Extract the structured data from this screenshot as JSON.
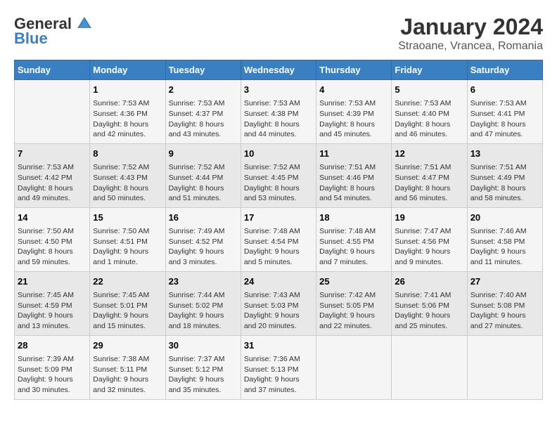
{
  "header": {
    "logo_general": "General",
    "logo_blue": "Blue",
    "month": "January 2024",
    "location": "Straoane, Vrancea, Romania"
  },
  "weekdays": [
    "Sunday",
    "Monday",
    "Tuesday",
    "Wednesday",
    "Thursday",
    "Friday",
    "Saturday"
  ],
  "weeks": [
    [
      {
        "day": "",
        "sunrise": "",
        "sunset": "",
        "daylight": ""
      },
      {
        "day": "1",
        "sunrise": "7:53 AM",
        "sunset": "4:36 PM",
        "daylight": "8 hours and 42 minutes."
      },
      {
        "day": "2",
        "sunrise": "7:53 AM",
        "sunset": "4:37 PM",
        "daylight": "8 hours and 43 minutes."
      },
      {
        "day": "3",
        "sunrise": "7:53 AM",
        "sunset": "4:38 PM",
        "daylight": "8 hours and 44 minutes."
      },
      {
        "day": "4",
        "sunrise": "7:53 AM",
        "sunset": "4:39 PM",
        "daylight": "8 hours and 45 minutes."
      },
      {
        "day": "5",
        "sunrise": "7:53 AM",
        "sunset": "4:40 PM",
        "daylight": "8 hours and 46 minutes."
      },
      {
        "day": "6",
        "sunrise": "7:53 AM",
        "sunset": "4:41 PM",
        "daylight": "8 hours and 47 minutes."
      }
    ],
    [
      {
        "day": "7",
        "sunrise": "7:53 AM",
        "sunset": "4:42 PM",
        "daylight": "8 hours and 49 minutes."
      },
      {
        "day": "8",
        "sunrise": "7:52 AM",
        "sunset": "4:43 PM",
        "daylight": "8 hours and 50 minutes."
      },
      {
        "day": "9",
        "sunrise": "7:52 AM",
        "sunset": "4:44 PM",
        "daylight": "8 hours and 51 minutes."
      },
      {
        "day": "10",
        "sunrise": "7:52 AM",
        "sunset": "4:45 PM",
        "daylight": "8 hours and 53 minutes."
      },
      {
        "day": "11",
        "sunrise": "7:51 AM",
        "sunset": "4:46 PM",
        "daylight": "8 hours and 54 minutes."
      },
      {
        "day": "12",
        "sunrise": "7:51 AM",
        "sunset": "4:47 PM",
        "daylight": "8 hours and 56 minutes."
      },
      {
        "day": "13",
        "sunrise": "7:51 AM",
        "sunset": "4:49 PM",
        "daylight": "8 hours and 58 minutes."
      }
    ],
    [
      {
        "day": "14",
        "sunrise": "7:50 AM",
        "sunset": "4:50 PM",
        "daylight": "8 hours and 59 minutes."
      },
      {
        "day": "15",
        "sunrise": "7:50 AM",
        "sunset": "4:51 PM",
        "daylight": "9 hours and 1 minute."
      },
      {
        "day": "16",
        "sunrise": "7:49 AM",
        "sunset": "4:52 PM",
        "daylight": "9 hours and 3 minutes."
      },
      {
        "day": "17",
        "sunrise": "7:48 AM",
        "sunset": "4:54 PM",
        "daylight": "9 hours and 5 minutes."
      },
      {
        "day": "18",
        "sunrise": "7:48 AM",
        "sunset": "4:55 PM",
        "daylight": "9 hours and 7 minutes."
      },
      {
        "day": "19",
        "sunrise": "7:47 AM",
        "sunset": "4:56 PM",
        "daylight": "9 hours and 9 minutes."
      },
      {
        "day": "20",
        "sunrise": "7:46 AM",
        "sunset": "4:58 PM",
        "daylight": "9 hours and 11 minutes."
      }
    ],
    [
      {
        "day": "21",
        "sunrise": "7:45 AM",
        "sunset": "4:59 PM",
        "daylight": "9 hours and 13 minutes."
      },
      {
        "day": "22",
        "sunrise": "7:45 AM",
        "sunset": "5:01 PM",
        "daylight": "9 hours and 15 minutes."
      },
      {
        "day": "23",
        "sunrise": "7:44 AM",
        "sunset": "5:02 PM",
        "daylight": "9 hours and 18 minutes."
      },
      {
        "day": "24",
        "sunrise": "7:43 AM",
        "sunset": "5:03 PM",
        "daylight": "9 hours and 20 minutes."
      },
      {
        "day": "25",
        "sunrise": "7:42 AM",
        "sunset": "5:05 PM",
        "daylight": "9 hours and 22 minutes."
      },
      {
        "day": "26",
        "sunrise": "7:41 AM",
        "sunset": "5:06 PM",
        "daylight": "9 hours and 25 minutes."
      },
      {
        "day": "27",
        "sunrise": "7:40 AM",
        "sunset": "5:08 PM",
        "daylight": "9 hours and 27 minutes."
      }
    ],
    [
      {
        "day": "28",
        "sunrise": "7:39 AM",
        "sunset": "5:09 PM",
        "daylight": "9 hours and 30 minutes."
      },
      {
        "day": "29",
        "sunrise": "7:38 AM",
        "sunset": "5:11 PM",
        "daylight": "9 hours and 32 minutes."
      },
      {
        "day": "30",
        "sunrise": "7:37 AM",
        "sunset": "5:12 PM",
        "daylight": "9 hours and 35 minutes."
      },
      {
        "day": "31",
        "sunrise": "7:36 AM",
        "sunset": "5:13 PM",
        "daylight": "9 hours and 37 minutes."
      },
      {
        "day": "",
        "sunrise": "",
        "sunset": "",
        "daylight": ""
      },
      {
        "day": "",
        "sunrise": "",
        "sunset": "",
        "daylight": ""
      },
      {
        "day": "",
        "sunrise": "",
        "sunset": "",
        "daylight": ""
      }
    ]
  ],
  "labels": {
    "sunrise": "Sunrise:",
    "sunset": "Sunset:",
    "daylight": "Daylight:"
  }
}
